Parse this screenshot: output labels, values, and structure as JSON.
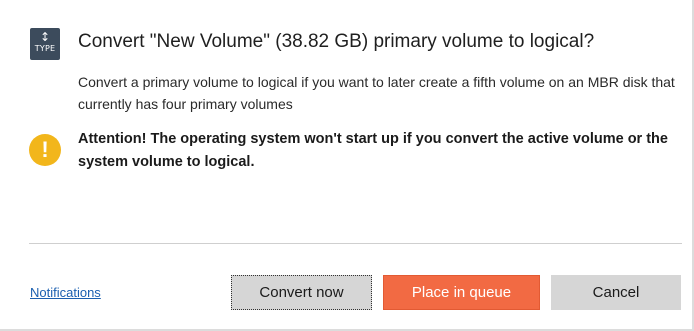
{
  "dialog": {
    "type_icon": {
      "arrows": "↕",
      "label": "TYPE",
      "color": "#3c4b5c"
    },
    "title": "Convert \"New Volume\" (38.82 GB) primary volume to logical?",
    "description": "Convert a primary volume to logical if you want to later create a fifth volume on an MBR disk that currently has four primary volumes",
    "warning": {
      "icon": "!",
      "icon_color": "#f2b61b",
      "text": "Attention! The operating system won't start up if you convert the active volume or the system volume to logical."
    }
  },
  "footer": {
    "notifications_link": "Notifications",
    "convert_now_label": "Convert now",
    "place_in_queue_label": "Place in queue",
    "cancel_label": "Cancel",
    "accent_color": "#f26a43"
  }
}
